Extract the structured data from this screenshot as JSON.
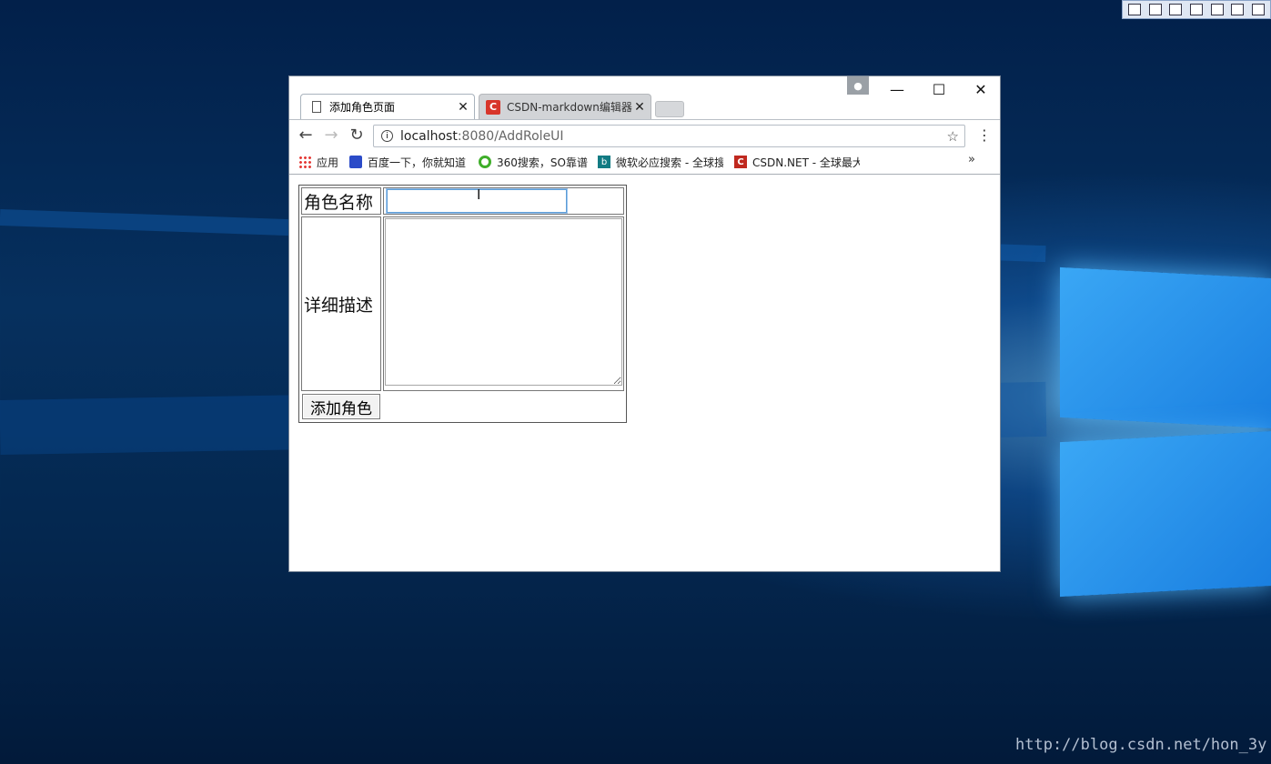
{
  "desktop": {
    "watermark": "http://blog.csdn.net/hon_3y",
    "toolbar_icons": [
      "open-icon",
      "window-icon",
      "restore-icon",
      "select-icon",
      "pin-icon",
      "fullscreen-icon",
      "download-icon"
    ]
  },
  "browser": {
    "tabs": [
      {
        "title": "添加角色页面",
        "icon": "document-icon",
        "active": true
      },
      {
        "title": "CSDN-markdown编辑器",
        "icon": "csdn-icon",
        "active": false
      }
    ],
    "window_controls": {
      "minimize": "—",
      "maximize": "☐",
      "close": "✕"
    },
    "url": {
      "host": "localhost",
      "path": ":8080/AddRoleUI"
    },
    "bookmarks": [
      {
        "label": "应用",
        "icon": "apps-grid-icon"
      },
      {
        "label": "百度一下，你就知道",
        "icon": "baidu-paw-icon"
      },
      {
        "label": "360搜索，SO靠谱",
        "icon": "360-search-icon"
      },
      {
        "label": "微软必应搜索 - 全球搜",
        "icon": "bing-icon"
      },
      {
        "label": "CSDN.NET - 全球最大",
        "icon": "csdn-icon"
      }
    ],
    "bookmarks_more": "»"
  },
  "form": {
    "name_label": "角色名称",
    "name_value": "",
    "desc_label": "详细描述",
    "desc_value": "",
    "submit_label": "添加角色"
  },
  "colors": {
    "desktop_bg": "#04274f",
    "accent_blue": "#3aa7f5",
    "csdn_red": "#d8352a"
  }
}
